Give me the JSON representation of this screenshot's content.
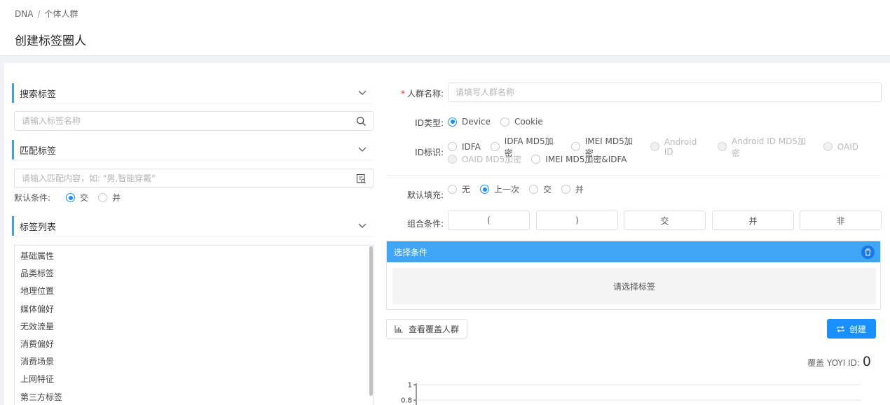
{
  "breadcrumb": {
    "root": "DNA",
    "sep": "/",
    "current": "个体人群"
  },
  "page_title": "创建标签圈人",
  "left": {
    "search_section": "搜索标签",
    "search_placeholder": "请输入标签名称",
    "match_section": "匹配标签",
    "match_placeholder": "请输入匹配内容，如: \"男,智能穿戴\"",
    "default_cond_label": "默认条件:",
    "default_cond_options": [
      "交",
      "并"
    ],
    "list_section": "标签列表",
    "tags": [
      "基础属性",
      "品类标签",
      "地理位置",
      "媒体偏好",
      "无效流量",
      "消费偏好",
      "消费场景",
      "上网特征",
      "第三方标签"
    ]
  },
  "form": {
    "name_label": "人群名称:",
    "name_placeholder": "请填写人群名称",
    "id_type_label": "ID类型:",
    "id_type_options": [
      "Device",
      "Cookie"
    ],
    "id_mark_label": "ID标识:",
    "id_mark_options": [
      "IDFA",
      "IDFA MD5加密",
      "IMEI MD5加密",
      "Android ID",
      "Android ID MD5加密",
      "OAID",
      "OAID MD5加密",
      "IMEI MD5加密&IDFA"
    ],
    "default_fill_label": "默认填充:",
    "default_fill_options": [
      "无",
      "上一次",
      "交",
      "并"
    ],
    "combo_label": "组合条件:",
    "combo_buttons": [
      "(",
      ")",
      "交",
      "并",
      "非"
    ]
  },
  "conditions": {
    "title": "选择条件",
    "empty": "请选择标签"
  },
  "actions": {
    "view": "查看覆盖人群",
    "create": "创建"
  },
  "coverage": {
    "label": "覆盖 YOYI ID:",
    "value": "0"
  },
  "chart_data": {
    "type": "line",
    "y_ticks": [
      "1",
      "0.8"
    ],
    "ylim": [
      0,
      1
    ]
  },
  "colors": {
    "accent": "#1890ff",
    "header_bar": "#41a5f5",
    "required": "#f5222d"
  }
}
